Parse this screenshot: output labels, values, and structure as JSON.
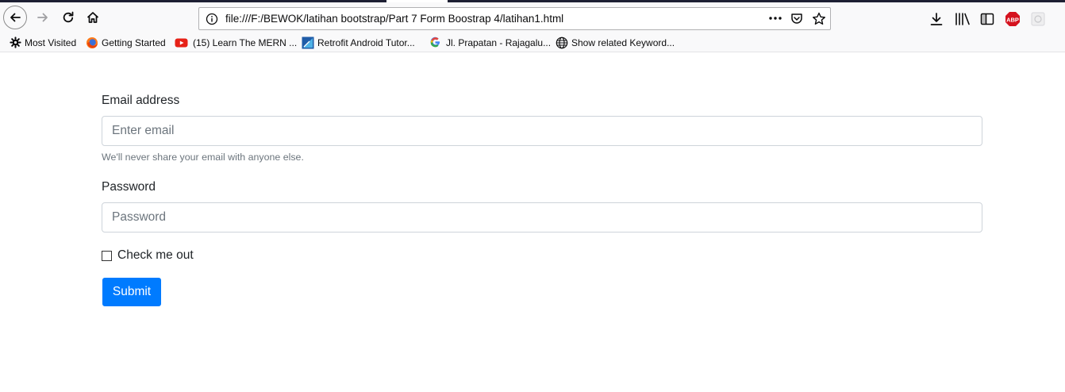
{
  "browser": {
    "url": "file:///F:/BEWOK/latihan bootstrap/Part 7 Form Boostrap 4/latihan1.html",
    "bookmarks": [
      {
        "label": "Most Visited",
        "icon": "gear-icon"
      },
      {
        "label": "Getting Started",
        "icon": "firefox-icon"
      },
      {
        "label": "(15) Learn The MERN ...",
        "icon": "youtube-icon"
      },
      {
        "label": "Retrofit Android Tutor...",
        "icon": "site-icon"
      },
      {
        "label": "Jl. Prapatan - Rajagalu...",
        "icon": "google-icon"
      },
      {
        "label": "Show related Keyword...",
        "icon": "globe-icon"
      }
    ],
    "abp_label": "ABP"
  },
  "form": {
    "email_label": "Email address",
    "email_placeholder": "Enter email",
    "email_help": "We'll never share your email with anyone else.",
    "password_label": "Password",
    "password_placeholder": "Password",
    "check_label": "Check me out",
    "submit_label": "Submit"
  },
  "colors": {
    "primary": "#007bff",
    "text": "#212529",
    "muted": "#6c757d",
    "border": "#ced4da"
  }
}
